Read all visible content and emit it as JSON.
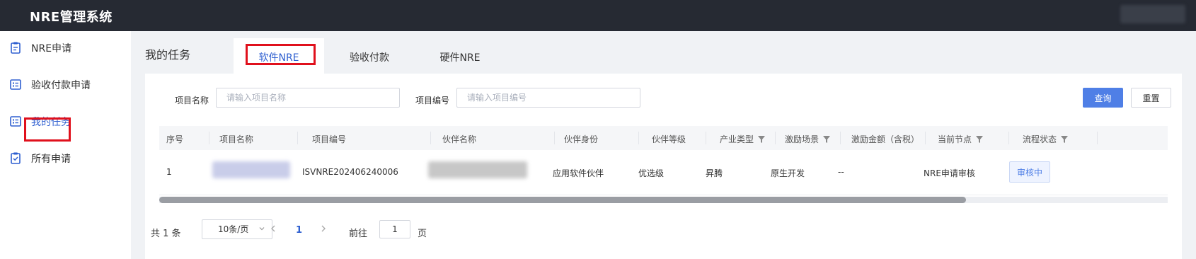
{
  "header": {
    "app_title": "NRE管理系统"
  },
  "sidebar": {
    "items": [
      {
        "label": "NRE申请",
        "icon": "clipboard-icon"
      },
      {
        "label": "验收付款申请",
        "icon": "checklist-icon"
      },
      {
        "label": "我的任务",
        "icon": "task-list-icon",
        "active": true
      },
      {
        "label": "所有申请",
        "icon": "clipboard-check-icon"
      }
    ]
  },
  "main": {
    "page_title": "我的任务",
    "tabs": [
      {
        "label": "软件NRE",
        "active": true
      },
      {
        "label": "验收付款"
      },
      {
        "label": "硬件NRE"
      }
    ]
  },
  "search": {
    "project_name_label": "项目名称",
    "project_name_placeholder": "请输入项目名称",
    "project_code_label": "项目编号",
    "project_code_placeholder": "请输入项目编号",
    "query_button": "查询",
    "reset_button": "重置"
  },
  "table": {
    "columns": [
      "序号",
      "项目名称",
      "项目编号",
      "伙伴名称",
      "伙伴身份",
      "伙伴等级",
      "产业类型",
      "激励场景",
      "激励金额（含税）",
      "当前节点",
      "流程状态"
    ],
    "rows": [
      {
        "index": "1",
        "project_name": "",
        "project_code": "ISVNRE202406240006",
        "partner_name": "",
        "partner_identity": "应用软件伙伴",
        "partner_level": "优选级",
        "industry_type": "昇腾",
        "incentive_scene": "原生开发",
        "incentive_amount": "--",
        "current_node": "NRE申请审核",
        "process_status": "审核中"
      }
    ],
    "scroll_position": 0,
    "visible_fraction": 0.8
  },
  "pagination": {
    "total_text": "共 1 条",
    "page_size": "10条/页",
    "current_page": "1",
    "goto_label": "前往",
    "goto_value": "1",
    "page_suffix": "页"
  },
  "colors": {
    "accent": "#2e5fd0",
    "primary_button": "#4f7fe6",
    "topbar": "#262a33",
    "highlight_box": "#e0101c"
  }
}
